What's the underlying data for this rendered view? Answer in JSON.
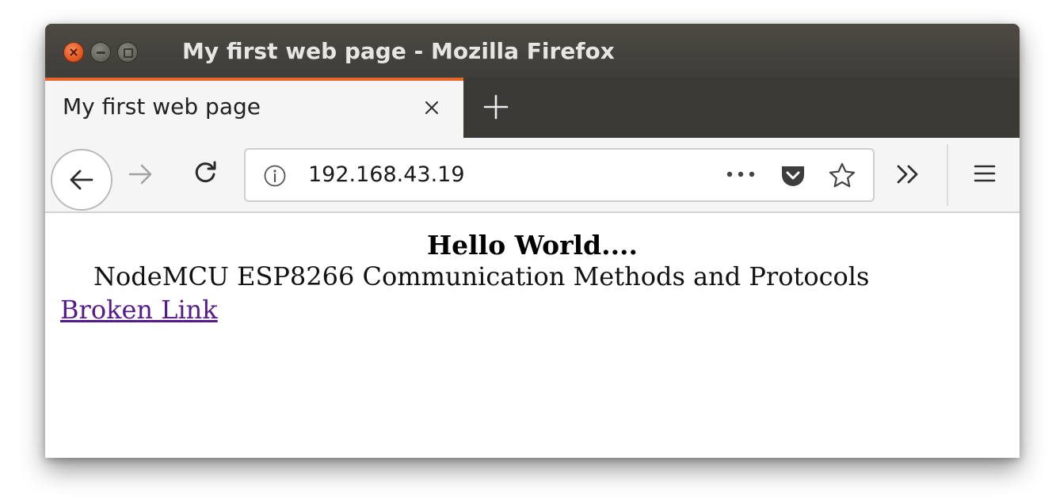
{
  "window": {
    "title": "My first web page - Mozilla Firefox"
  },
  "tabs": [
    {
      "label": "My first web page",
      "active": true
    }
  ],
  "navbar": {
    "url": "192.168.43.19"
  },
  "page": {
    "heading": "Hello World....",
    "paragraph": "NodeMCU ESP8266 Communication Methods and Protocols",
    "link_text": "Broken Link"
  },
  "colors": {
    "titlebar": "#3f3d38",
    "active_tab_accent": "#e5672a",
    "close_button": "#e0561f",
    "visited_link": "#551a8b"
  },
  "icons": [
    "close-icon",
    "minimize-icon",
    "maximize-icon",
    "tab-close-icon",
    "plus-icon",
    "back-arrow-icon",
    "forward-arrow-icon",
    "reload-icon",
    "info-icon",
    "ellipsis-icon",
    "pocket-icon",
    "star-icon",
    "chevron-double-right-icon",
    "hamburger-menu-icon"
  ]
}
